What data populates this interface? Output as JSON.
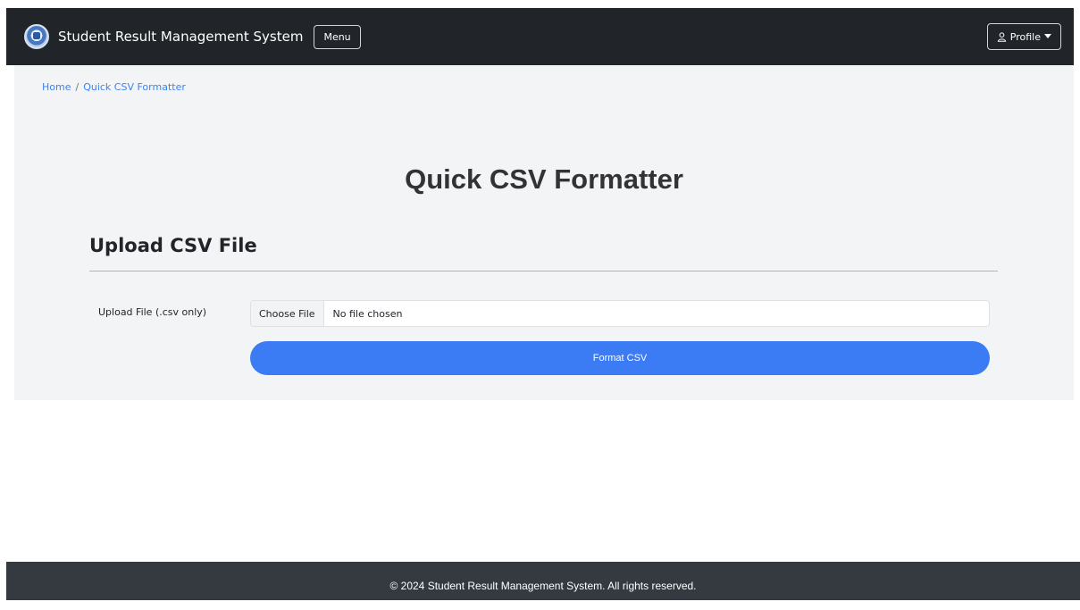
{
  "navbar": {
    "brand_title": "Student Result Management System",
    "menu_label": "Menu",
    "profile_label": "Profile"
  },
  "breadcrumb": {
    "home": "Home",
    "separator": "/",
    "current": "Quick CSV Formatter"
  },
  "page": {
    "title": "Quick CSV Formatter",
    "section_title": "Upload CSV File"
  },
  "form": {
    "upload_label": "Upload File (.csv only)",
    "choose_file_label": "Choose File",
    "file_status": "No file chosen",
    "submit_label": "Format CSV"
  },
  "footer": {
    "text": "© 2024 Student Result Management System. All rights reserved."
  },
  "colors": {
    "navbar_bg": "#212529",
    "accent": "#3b7cf5",
    "link": "#3b82f6",
    "main_bg": "#f3f4f6",
    "footer_bg": "#343a40"
  }
}
